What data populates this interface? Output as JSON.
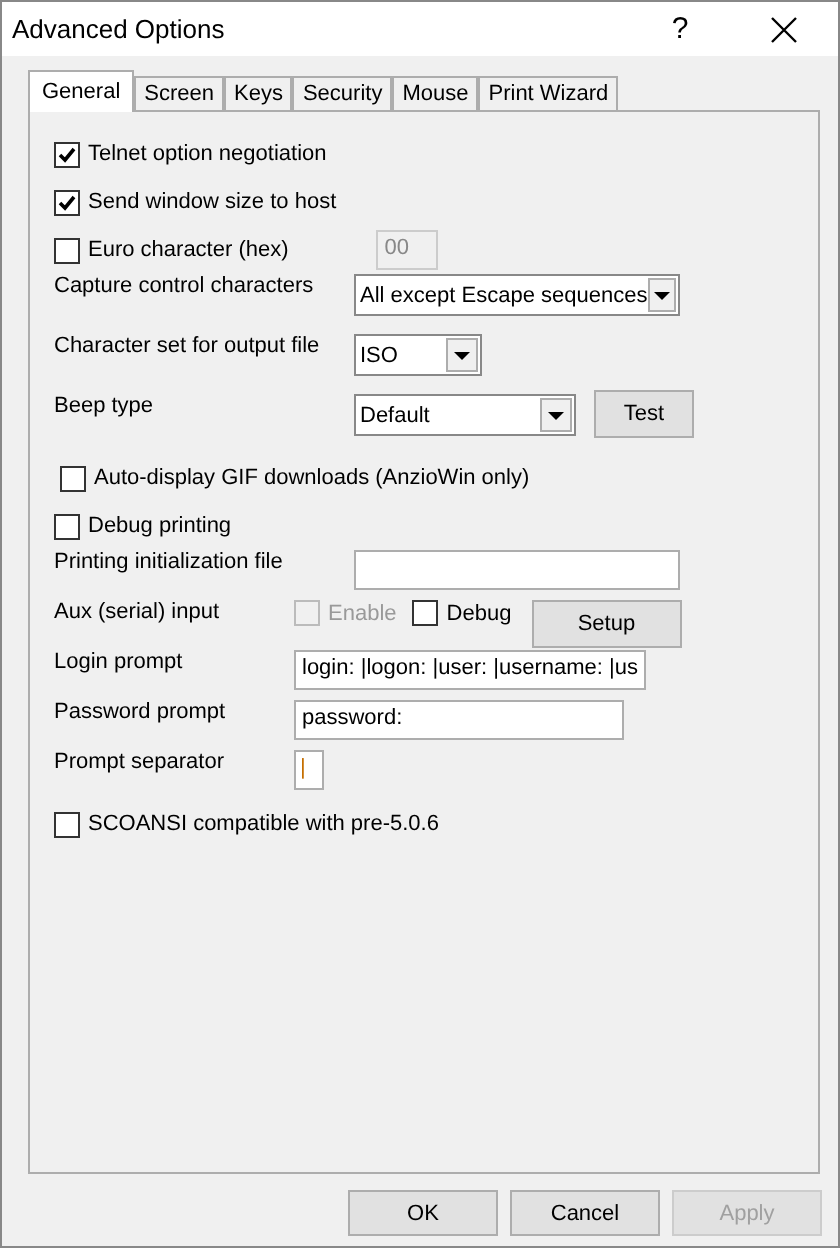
{
  "window": {
    "title": "Advanced Options",
    "help": "?"
  },
  "tabs": [
    {
      "label": "General",
      "selected": true
    },
    {
      "label": "Screen",
      "selected": false
    },
    {
      "label": "Keys",
      "selected": false
    },
    {
      "label": "Security",
      "selected": false
    },
    {
      "label": "Mouse",
      "selected": false
    },
    {
      "label": "Print Wizard",
      "selected": false
    }
  ],
  "rows": [
    {
      "kind": "checkbox",
      "label": "Telnet option negotiation",
      "checked": true
    },
    {
      "kind": "checkbox",
      "label": "Send window size to host",
      "checked": true
    },
    {
      "kind": "hex",
      "label": "Euro character (hex)",
      "checked": false,
      "value": "00",
      "disabled": true
    },
    {
      "kind": "select",
      "label": "Capture control characters",
      "value": "All except Escape sequences"
    },
    {
      "kind": "select",
      "label": "Character set for output file",
      "value": "ISO"
    },
    {
      "kind": "select",
      "label": "Beep type",
      "value": "Default",
      "button": "Test"
    },
    {
      "kind": "checkbox",
      "label": "Auto-display GIF downloads (AnzioWin only)",
      "checked": false
    },
    {
      "kind": "checkbox",
      "label": "Debug printing",
      "checked": false
    },
    {
      "kind": "field",
      "label": "Printing initialization file"
    },
    {
      "kind": "aux",
      "label": "Aux (serial) input",
      "options": [
        {
          "label": "Enable",
          "checked": false,
          "disabled": true
        },
        {
          "label": "Debug",
          "checked": false,
          "disabled": false
        }
      ],
      "button": "Setup"
    },
    {
      "kind": "field",
      "label": "Login prompt",
      "value": "login: |logon: |user: |username: |us"
    },
    {
      "kind": "field",
      "label": "Password prompt",
      "value": "password:"
    },
    {
      "kind": "field",
      "label": "Prompt separator",
      "value": "|"
    },
    {
      "kind": "checkbox",
      "label": "SCOANSI compatible with pre-5.0.6",
      "checked": false
    }
  ],
  "buttons": [
    {
      "label": "OK",
      "disabled": false
    },
    {
      "label": "Cancel",
      "disabled": false
    },
    {
      "label": "Apply",
      "disabled": true
    }
  ]
}
